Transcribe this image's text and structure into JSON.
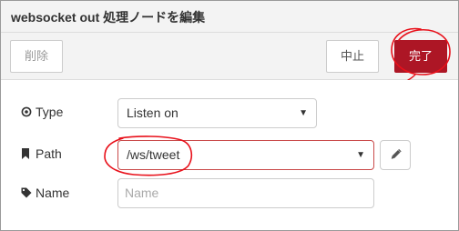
{
  "dialog": {
    "title": "websocket out 処理ノードを編集"
  },
  "toolbar": {
    "delete_label": "削除",
    "cancel_label": "中止",
    "done_label": "完了"
  },
  "form": {
    "type": {
      "label": "Type",
      "icon": "radio-circle-icon",
      "selected": "Listen on"
    },
    "path": {
      "label": "Path",
      "icon": "bookmark-icon",
      "selected": "/ws/tweet",
      "edit_icon": "pencil-icon"
    },
    "name": {
      "label": "Name",
      "icon": "tag-icon",
      "placeholder": "Name",
      "value": ""
    }
  },
  "colors": {
    "primary": "#ad1625",
    "annotation": "#e8101a",
    "header_bg": "#f3f3f3"
  }
}
